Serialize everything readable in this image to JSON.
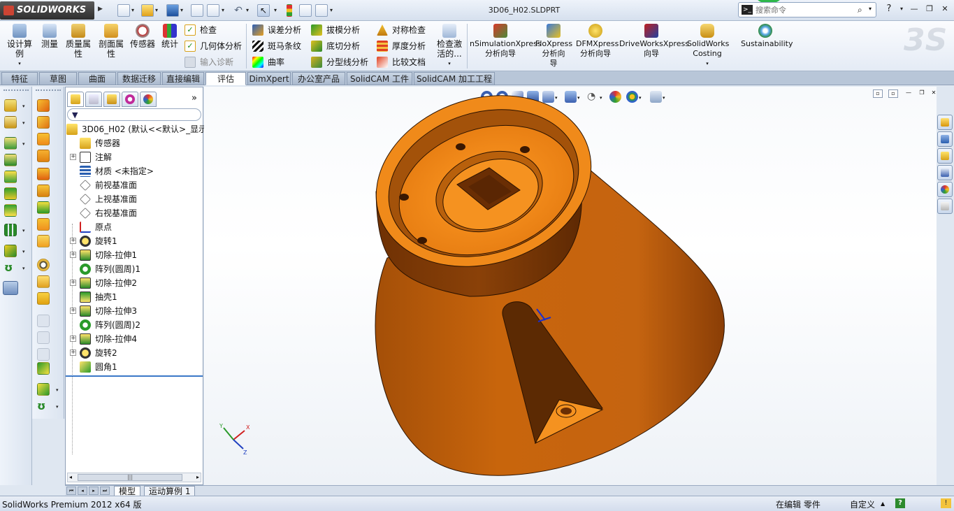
{
  "app": {
    "brand": "SOLIDWORKS",
    "document_name": "3D06_H02.SLDPRT",
    "search_placeholder": "搜索命令",
    "help_label": "?"
  },
  "command_manager": {
    "large_buttons": [
      {
        "id": "design-study",
        "label": "设计算\n例",
        "icon": "design-study-icon"
      },
      {
        "id": "measure",
        "label": "测量",
        "icon": "measure-icon"
      },
      {
        "id": "mass-properties",
        "label": "质量属\n性",
        "icon": "mass-properties-icon"
      },
      {
        "id": "section-properties",
        "label": "剖面属\n性",
        "icon": "section-properties-icon"
      },
      {
        "id": "sensor",
        "label": "传感器",
        "icon": "sensor-gauge-icon"
      },
      {
        "id": "statistics",
        "label": "统计",
        "icon": "statistics-icon"
      }
    ],
    "small_buttons_col1": [
      {
        "label": "检查",
        "icon": "check-icon",
        "disabled": false
      },
      {
        "label": "几何体分析",
        "icon": "geometry-analysis-icon",
        "disabled": false
      },
      {
        "label": "输入诊断",
        "icon": "import-diagnostics-icon",
        "disabled": true
      }
    ],
    "small_buttons_col2": [
      {
        "label": "误差分析",
        "icon": "deviation-analysis-icon"
      },
      {
        "label": "斑马条纹",
        "icon": "zebra-stripes-icon"
      },
      {
        "label": "曲率",
        "icon": "curvature-icon"
      }
    ],
    "small_buttons_col3": [
      {
        "label": "拔模分析",
        "icon": "draft-analysis-icon"
      },
      {
        "label": "底切分析",
        "icon": "undercut-analysis-icon"
      },
      {
        "label": "分型线分析",
        "icon": "parting-line-analysis-icon"
      }
    ],
    "small_buttons_col4": [
      {
        "label": "对称检查",
        "icon": "symmetry-check-icon"
      },
      {
        "label": "厚度分析",
        "icon": "thickness-analysis-icon"
      },
      {
        "label": "比较文档",
        "icon": "compare-documents-icon"
      }
    ],
    "check_active": {
      "label": "检查激\n活的...",
      "icon": "check-active-icon"
    },
    "xpress_buttons": [
      {
        "label": "nSimulationXpress\n分析向导",
        "icon": "simulationxpress-icon"
      },
      {
        "label": "FloXpress\n分析向\n导",
        "icon": "floxpress-icon"
      },
      {
        "label": "DFMXpress\n分析向导",
        "icon": "dfmxpress-icon"
      },
      {
        "label": "DriveWorksXpress\n向导",
        "icon": "driveworksxpress-icon"
      },
      {
        "label": "SolidWorks\nCosting",
        "icon": "costing-icon"
      },
      {
        "label": "Sustainability",
        "icon": "sustainability-icon"
      }
    ]
  },
  "tabs": [
    {
      "label": "特征",
      "active": false
    },
    {
      "label": "草图",
      "active": false
    },
    {
      "label": "曲面",
      "active": false
    },
    {
      "label": "数据迁移",
      "active": false
    },
    {
      "label": "直接编辑",
      "active": false
    },
    {
      "label": "评估",
      "active": true
    },
    {
      "label": "DimXpert",
      "active": false
    },
    {
      "label": "办公室产品",
      "active": false
    },
    {
      "label": "SolidCAM 工件",
      "active": false
    },
    {
      "label": "SolidCAM 加工工程",
      "active": false
    }
  ],
  "feature_tree": {
    "root_label": "3D06_H02  (默认<<默认>_显示",
    "items": [
      {
        "label": "传感器",
        "icon": "sensors-folder-icon",
        "expandable": false
      },
      {
        "label": "注解",
        "icon": "annotations-icon",
        "expandable": true
      },
      {
        "label": "材质 <未指定>",
        "icon": "material-icon",
        "expandable": false
      },
      {
        "label": "前视基准面",
        "icon": "plane-icon",
        "expandable": false
      },
      {
        "label": "上视基准面",
        "icon": "plane-icon",
        "expandable": false
      },
      {
        "label": "右视基准面",
        "icon": "plane-icon",
        "expandable": false
      },
      {
        "label": "原点",
        "icon": "origin-icon",
        "expandable": false
      },
      {
        "label": "旋转1",
        "icon": "revolve-icon",
        "expandable": true
      },
      {
        "label": "切除-拉伸1",
        "icon": "cut-extrude-icon",
        "expandable": true
      },
      {
        "label": "阵列(圆周)1",
        "icon": "circular-pattern-icon",
        "expandable": false
      },
      {
        "label": "切除-拉伸2",
        "icon": "cut-extrude-icon",
        "expandable": true
      },
      {
        "label": "抽壳1",
        "icon": "shell-icon",
        "expandable": false
      },
      {
        "label": "切除-拉伸3",
        "icon": "cut-extrude-icon",
        "expandable": true
      },
      {
        "label": "阵列(圆周)2",
        "icon": "circular-pattern-icon",
        "expandable": false
      },
      {
        "label": "切除-拉伸4",
        "icon": "cut-extrude-icon",
        "expandable": true
      },
      {
        "label": "旋转2",
        "icon": "revolve-icon",
        "expandable": true
      },
      {
        "label": "圆角1",
        "icon": "fillet-icon",
        "expandable": false
      }
    ]
  },
  "model_tabs": [
    {
      "label": "模型",
      "active": true
    },
    {
      "label": "运动算例 1",
      "active": false
    }
  ],
  "status_bar": {
    "product": "SolidWorks Premium 2012 x64 版",
    "mode": "在编辑 零件",
    "units": "自定义",
    "units_arrow": "▲"
  },
  "triad": {
    "x": "X",
    "y": "Y",
    "z": "Z"
  },
  "colors": {
    "part_body": "#c8650c",
    "part_face_light": "#f08a1a",
    "part_shadow": "#6a2d04",
    "accent_blue": "#3a78c8"
  }
}
